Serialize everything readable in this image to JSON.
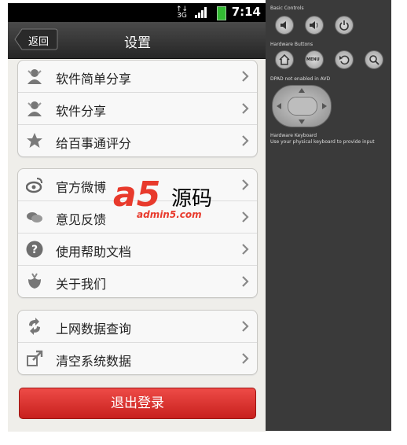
{
  "status_bar": {
    "network": "3G",
    "time": "7:14"
  },
  "header": {
    "back_label": "返回",
    "title": "设置"
  },
  "groups": [
    {
      "items": [
        {
          "label": "软件简单分享",
          "icon": "share-person-icon"
        },
        {
          "label": "软件分享",
          "icon": "share-person-icon"
        },
        {
          "label": "给百事通评分",
          "icon": "star-icon"
        }
      ]
    },
    {
      "items": [
        {
          "label": "官方微博",
          "icon": "weibo-icon"
        },
        {
          "label": "意见反馈",
          "icon": "chat-bubbles-icon"
        },
        {
          "label": "使用帮助文档",
          "icon": "help-icon"
        },
        {
          "label": "关于我们",
          "icon": "flower-icon"
        }
      ]
    },
    {
      "items": [
        {
          "label": "上网数据查询",
          "icon": "refresh-arrows-icon"
        },
        {
          "label": "清空系统数据",
          "icon": "export-icon"
        }
      ]
    }
  ],
  "logout_label": "退出登录",
  "emulator_panel": {
    "basic_controls": "Basic Controls",
    "hardware_buttons": "Hardware Buttons",
    "menu_label": "MENU",
    "dpad_note": "DPAD not enabled in AVD",
    "keyboard_title": "Hardware Keyboard",
    "keyboard_note": "Use your physical keyboard to provide input"
  },
  "watermark": {
    "mark": "a5",
    "text": "源码",
    "url": "admin5.com"
  },
  "colors": {
    "logout": "#d8312d",
    "titlebar": "#333333",
    "panel": "#3a3a3a"
  }
}
